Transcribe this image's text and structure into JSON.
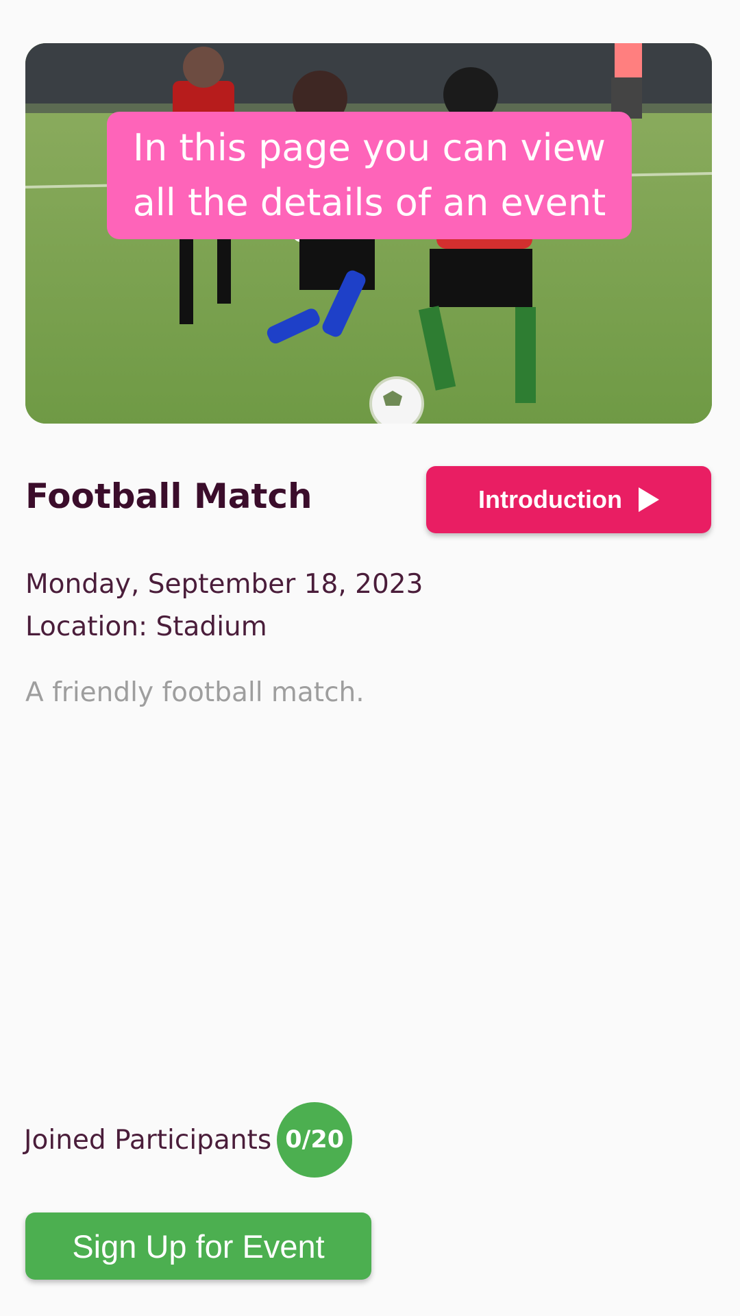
{
  "event": {
    "image_alt": "Children playing football on a grass field",
    "title": "Football Match",
    "date": "Monday, September 18, 2023",
    "location": "Location: Stadium",
    "description": "A friendly football match."
  },
  "tooltip": {
    "line1": "In this page you can view",
    "line2": "all the details of an event"
  },
  "introduction_button": {
    "label": "Introduction",
    "icon": "play-icon"
  },
  "participants": {
    "label": "Joined Participants",
    "count": "0/20"
  },
  "signup_button": {
    "label": "Sign Up for Event"
  },
  "colors": {
    "background": "#fafafa",
    "tooltip": "#fe64b9",
    "primary_pink": "#e91e63",
    "green": "#4caf50",
    "title_text": "#3b0d2b",
    "body_text": "#4a1d3a",
    "muted_text": "#9e9e9e"
  }
}
